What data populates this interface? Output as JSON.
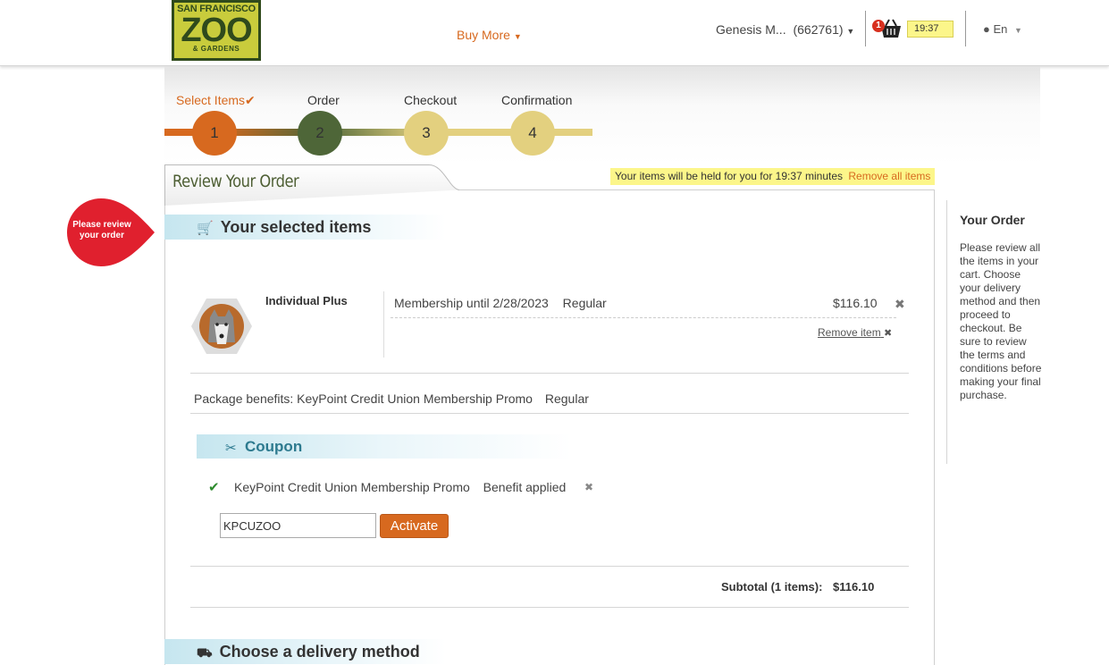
{
  "header": {
    "logo": {
      "top": "SAN FRANCISCO",
      "main": "ZOO",
      "bottom": "& GARDENS"
    },
    "buy_more": "Buy More",
    "user_name": "Genesis M...",
    "user_id": "(662761)",
    "cart_count": "1",
    "timer": "19:37",
    "language": "En"
  },
  "steps": [
    {
      "label": "Select Items",
      "number": "1",
      "color": "#d7691f",
      "done": true
    },
    {
      "label": "Order",
      "number": "2",
      "color": "#4e6638",
      "done": false
    },
    {
      "label": "Checkout",
      "number": "3",
      "color": "#e3d07f",
      "done": false
    },
    {
      "label": "Confirmation",
      "number": "4",
      "color": "#e3d07f",
      "done": false
    }
  ],
  "review": {
    "title": "Review Your Order",
    "hold_notice": "Your items will be held for you for 19:37 minutes",
    "remove_all": "Remove all items",
    "prompt_bubble": "Please review your order"
  },
  "selected_items": {
    "heading": "Your selected items",
    "items": [
      {
        "name": "Individual Plus",
        "description": "Membership until 2/28/2023",
        "type": "Regular",
        "price": "$116.10",
        "remove_label": "Remove item"
      }
    ],
    "package_benefits": "Package benefits: KeyPoint Credit Union Membership Promo",
    "package_type": "Regular"
  },
  "coupon": {
    "heading": "Coupon",
    "applied_name": "KeyPoint Credit Union Membership Promo",
    "applied_status": "Benefit applied",
    "code_value": "KPCUZOO",
    "activate_label": "Activate"
  },
  "subtotal": {
    "label": "Subtotal (1 items):",
    "amount": "$116.10"
  },
  "delivery": {
    "heading": "Choose a delivery method"
  },
  "sidebar": {
    "title": "Your Order",
    "text": "Please review all the items in your cart. Choose your delivery method and then proceed to checkout. Be sure to review the terms and conditions before making your final purchase."
  },
  "colors": {
    "accent": "#d7691f",
    "olive": "#4e6638",
    "sand": "#e3d07f",
    "alert_red": "#e0202e",
    "highlight": "#fcf68a"
  }
}
